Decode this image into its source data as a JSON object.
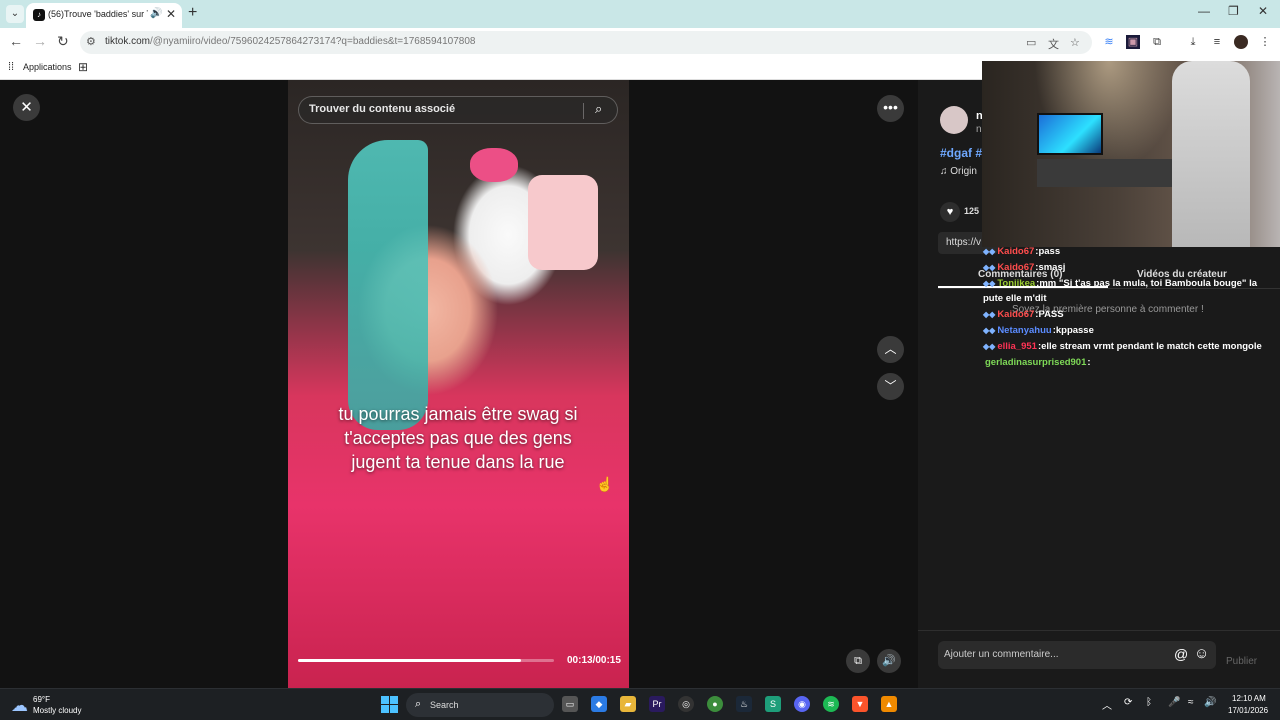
{
  "browser": {
    "tab_title": "(56)Trouve 'baddies' sur TikTok",
    "url_host": "tiktok.com",
    "url_path": "/@nyamiiro/video/7596024257864273174?q=baddies&t=1768594107808",
    "bookmark_apps": "Applications"
  },
  "search": {
    "placeholder": "Trouver du contenu associé"
  },
  "video": {
    "caption": "tu pourras jamais être swag si t'acceptes pas que des gens jugent ta tenue dans la rue",
    "timecode": "00:13/00:15",
    "progress": 0.87
  },
  "panel": {
    "name_initial": "n",
    "sub_initial": "n",
    "hashtags": "#dgaf #",
    "music": "Origin",
    "like_count": "125",
    "link_text": "https://v",
    "tab_comments": "Commentaires (0)",
    "tab_creator_videos": "Vidéos du créateur",
    "no_comments": "Soyez la première personne à commenter !",
    "comment_placeholder": "Ajouter un commentaire...",
    "publish_label": "Publier"
  },
  "chat": {
    "messages": [
      {
        "user": "Kaido67",
        "color": "#ff4d4d",
        "text": "pass"
      },
      {
        "user": "Kaido67",
        "color": "#ff4d4d",
        "text": "smasj"
      },
      {
        "user": "Toniikea",
        "color": "#9acd32",
        "text": "mm \"Si t'as pas la mula, toi Bamboula bouge\" la pute elle m'dit"
      },
      {
        "user": "Kaido67",
        "color": "#ff4d4d",
        "text": "PASS"
      },
      {
        "user": "Netanyahuu",
        "color": "#5b8cff",
        "text": "kppasse"
      },
      {
        "user": "ellia_951",
        "color": "#ff3355",
        "text": "elle stream vrmt pendant le match cette mongole"
      },
      {
        "user": "gerladinasurprised901",
        "color": "#7ed957",
        "text": ""
      }
    ]
  },
  "taskbar": {
    "weather_temp": "69°F",
    "weather_cond": "Mostly cloudy",
    "search_label": "Search",
    "time": "12:10 AM",
    "date": "17/01/2026"
  }
}
